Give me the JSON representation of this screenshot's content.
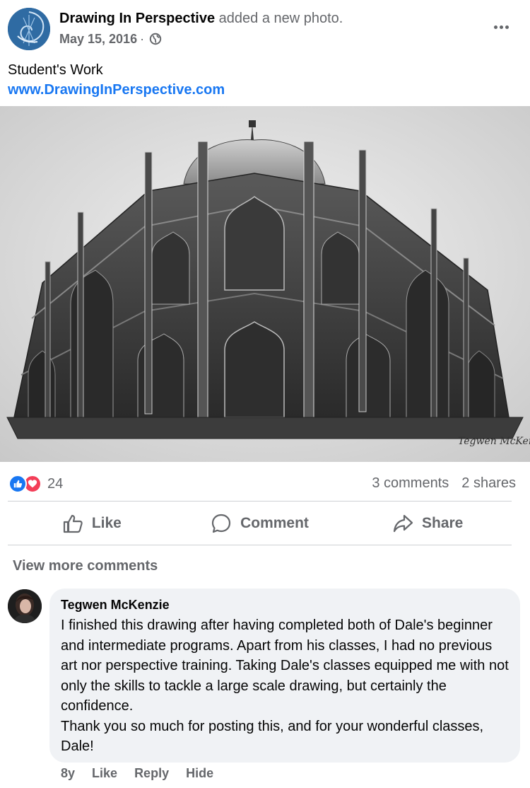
{
  "post": {
    "author": "Drawing In Perspective",
    "action": "added a new photo.",
    "date": "May 15, 2016",
    "separator": "·",
    "privacy_icon": "globe-icon",
    "more_icon": "more-options-icon",
    "text": "Student's Work",
    "link": "www.DrawingInPerspective.com",
    "photo_signature": "Tegwen McKenzie"
  },
  "stats": {
    "reactions": [
      "like",
      "love"
    ],
    "reaction_count": "24",
    "comments": "3 comments",
    "shares": "2 shares"
  },
  "actions": {
    "like": "Like",
    "comment": "Comment",
    "share": "Share"
  },
  "comments_section": {
    "view_more": "View more comments",
    "comment": {
      "author": "Tegwen McKenzie",
      "text": "I finished this drawing after having completed both of Dale's beginner and intermediate programs. Apart from his classes, I had no previous art nor perspective training. Taking Dale's classes equipped me with not only the skills to tackle a large scale drawing, but certainly the confidence.\nThank you so much for posting this, and for your wonderful classes, Dale!",
      "age": "8y",
      "like": "Like",
      "reply": "Reply",
      "hide": "Hide"
    }
  },
  "colors": {
    "link_blue": "#1877f2",
    "secondary_text": "#65676b",
    "bubble_bg": "#f0f2f5",
    "love_red": "#f33e58"
  }
}
